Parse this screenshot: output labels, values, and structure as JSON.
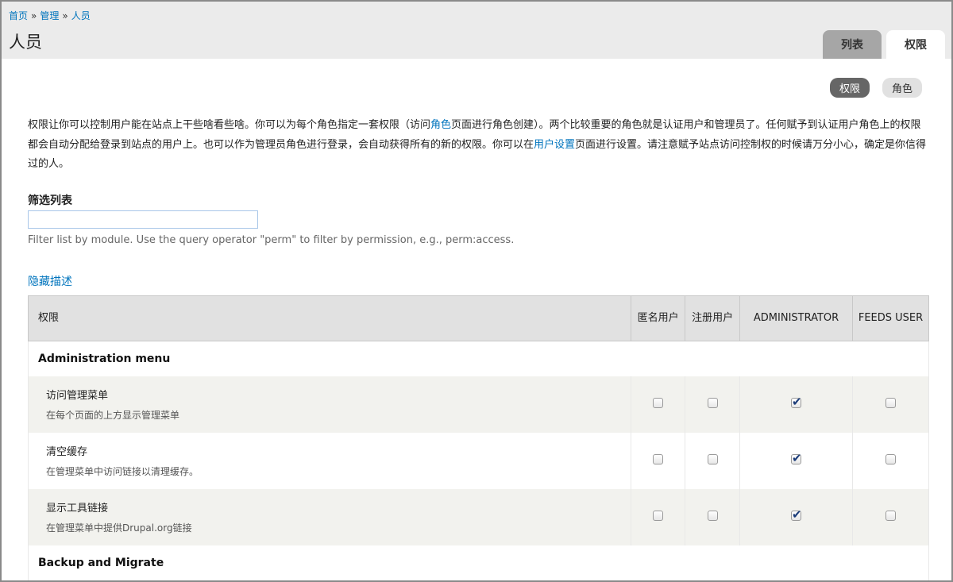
{
  "breadcrumb": {
    "items": [
      "首页",
      "管理",
      "人员"
    ],
    "separator": "»"
  },
  "page_title": "人员",
  "primary_tabs": [
    {
      "label": "列表",
      "active": false
    },
    {
      "label": "权限",
      "active": true
    }
  ],
  "secondary_tabs": [
    {
      "label": "权限",
      "active": true
    },
    {
      "label": "角色",
      "active": false
    }
  ],
  "description": {
    "part1": "权限让你可以控制用户能在站点上干些啥看些啥。你可以为每个角色指定一套权限（访问",
    "link1": "角色",
    "part2": "页面进行角色创建）。两个比较重要的角色就是认证用户和管理员了。任何赋予到认证用户角色上的权限都会自动分配给登录到站点的用户上。也可以作为管理员角色进行登录，会自动获得所有的新的权限。你可以在",
    "link2": "用户设置",
    "part3": "页面进行设置。请注意赋予站点访问控制权的时候请万分小心，确定是你信得过的人。"
  },
  "filter": {
    "label": "筛选列表",
    "value": "",
    "placeholder": "",
    "help": "Filter list by module. Use the query operator \"perm\" to filter by permission, e.g., perm:access."
  },
  "hide_descriptions_link": "隐藏描述",
  "table": {
    "headers": {
      "permission": "权限",
      "roles": [
        "匿名用户",
        "注册用户",
        "ADMINISTRATOR",
        "FEEDS USER"
      ]
    },
    "modules": [
      {
        "name": "Administration menu",
        "permissions": [
          {
            "title": "访问管理菜单",
            "description": "在每个页面的上方显示管理菜单",
            "checked": [
              false,
              false,
              true,
              false
            ]
          },
          {
            "title": "清空缓存",
            "description": "在管理菜单中访问链接以清理缓存。",
            "checked": [
              false,
              false,
              true,
              false
            ]
          },
          {
            "title": "显示工具链接",
            "description": "在管理菜单中提供Drupal.org链接",
            "checked": [
              false,
              false,
              true,
              false
            ]
          }
        ]
      },
      {
        "name": "Backup and Migrate",
        "permissions": []
      }
    ]
  },
  "colors": {
    "link": "#0074bd",
    "header_bg": "#ebebeb",
    "checkmark": "#1b3c79"
  }
}
